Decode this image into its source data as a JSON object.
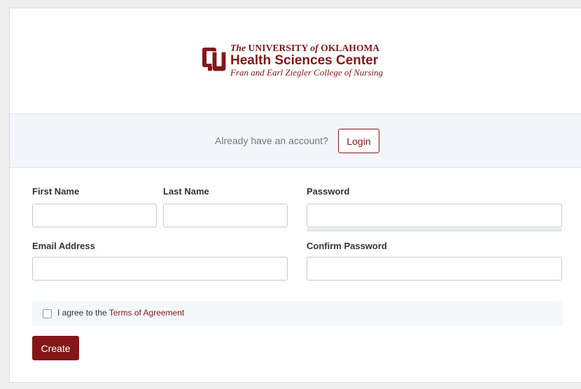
{
  "branding": {
    "line1_prefix": "The",
    "line1_main": "UNIVERSITY",
    "line1_of": "of",
    "line1_suffix": "OKLAHOMA",
    "line2": "Health Sciences Center",
    "line3": "Fran and Earl Ziegler College of Nursing",
    "brand_color": "#841617",
    "logo_icon": "ou-interlocking-logo-icon"
  },
  "login_bar": {
    "prompt": "Already have an account?",
    "login_label": "Login"
  },
  "form": {
    "first_name": {
      "label": "First Name",
      "value": "",
      "placeholder": ""
    },
    "last_name": {
      "label": "Last Name",
      "value": "",
      "placeholder": ""
    },
    "password": {
      "label": "Password",
      "value": "",
      "placeholder": ""
    },
    "email": {
      "label": "Email Address",
      "value": "",
      "placeholder": ""
    },
    "confirm_password": {
      "label": "Confirm Password",
      "value": "",
      "placeholder": ""
    },
    "password_strength": 0,
    "terms": {
      "checked": false,
      "text": "I agree to the",
      "link": "Terms of Agreement"
    },
    "create_label": "Create"
  },
  "colors": {
    "accent": "#841617",
    "login_bar_bg": "#f2f6fa",
    "terms_bg": "#f5f8fa"
  }
}
